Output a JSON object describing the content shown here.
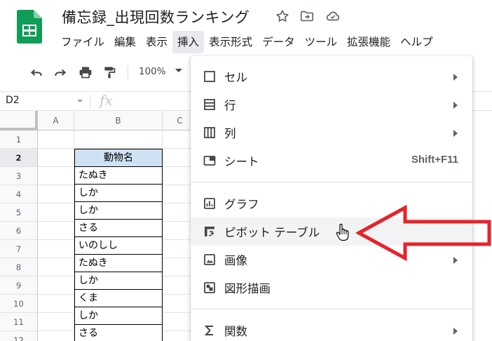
{
  "document": {
    "title": "備忘録_出現回数ランキング"
  },
  "menu": [
    "ファイル",
    "編集",
    "表示",
    "挿入",
    "表示形式",
    "データ",
    "ツール",
    "拡張機能",
    "ヘルプ"
  ],
  "toolbar": {
    "zoom": "100%"
  },
  "formula_bar": {
    "name_box": "D2",
    "fx_symbol": "fx"
  },
  "grid": {
    "columns": [
      "A",
      "B",
      "C"
    ],
    "rows": [
      "1",
      "2",
      "3",
      "4",
      "5",
      "6",
      "7",
      "8",
      "9",
      "10",
      "11",
      "12"
    ],
    "active_row": "2",
    "cells": {
      "b2": "動物名",
      "b3": "たぬき",
      "b4": "しか",
      "b5": "しか",
      "b6": "さる",
      "b7": "いのしし",
      "b8": "たぬき",
      "b9": "しか",
      "b10": "くま",
      "b11": "しか",
      "b12": "さる"
    }
  },
  "insert_menu": {
    "items": [
      {
        "label": "セル",
        "icon": "cell-icon",
        "submenu": true
      },
      {
        "label": "行",
        "icon": "rows-icon",
        "submenu": true
      },
      {
        "label": "列",
        "icon": "columns-icon",
        "submenu": true
      },
      {
        "label": "シート",
        "icon": "sheet-icon",
        "shortcut": "Shift+F11"
      },
      {
        "label": "グラフ",
        "icon": "chart-icon"
      },
      {
        "label": "ピボット テーブル",
        "icon": "pivot-table-icon",
        "hovered": true
      },
      {
        "label": "画像",
        "icon": "image-icon",
        "submenu": true
      },
      {
        "label": "図形描画",
        "icon": "drawing-icon"
      },
      {
        "label": "関数",
        "icon": "sigma-icon",
        "submenu": true
      }
    ]
  },
  "colors": {
    "sheets_green": "#0f9d58",
    "header_cell_fill": "#cfe2f3",
    "annotation_arrow": "#e8222a",
    "menu_hover": "#f1f3f4"
  }
}
